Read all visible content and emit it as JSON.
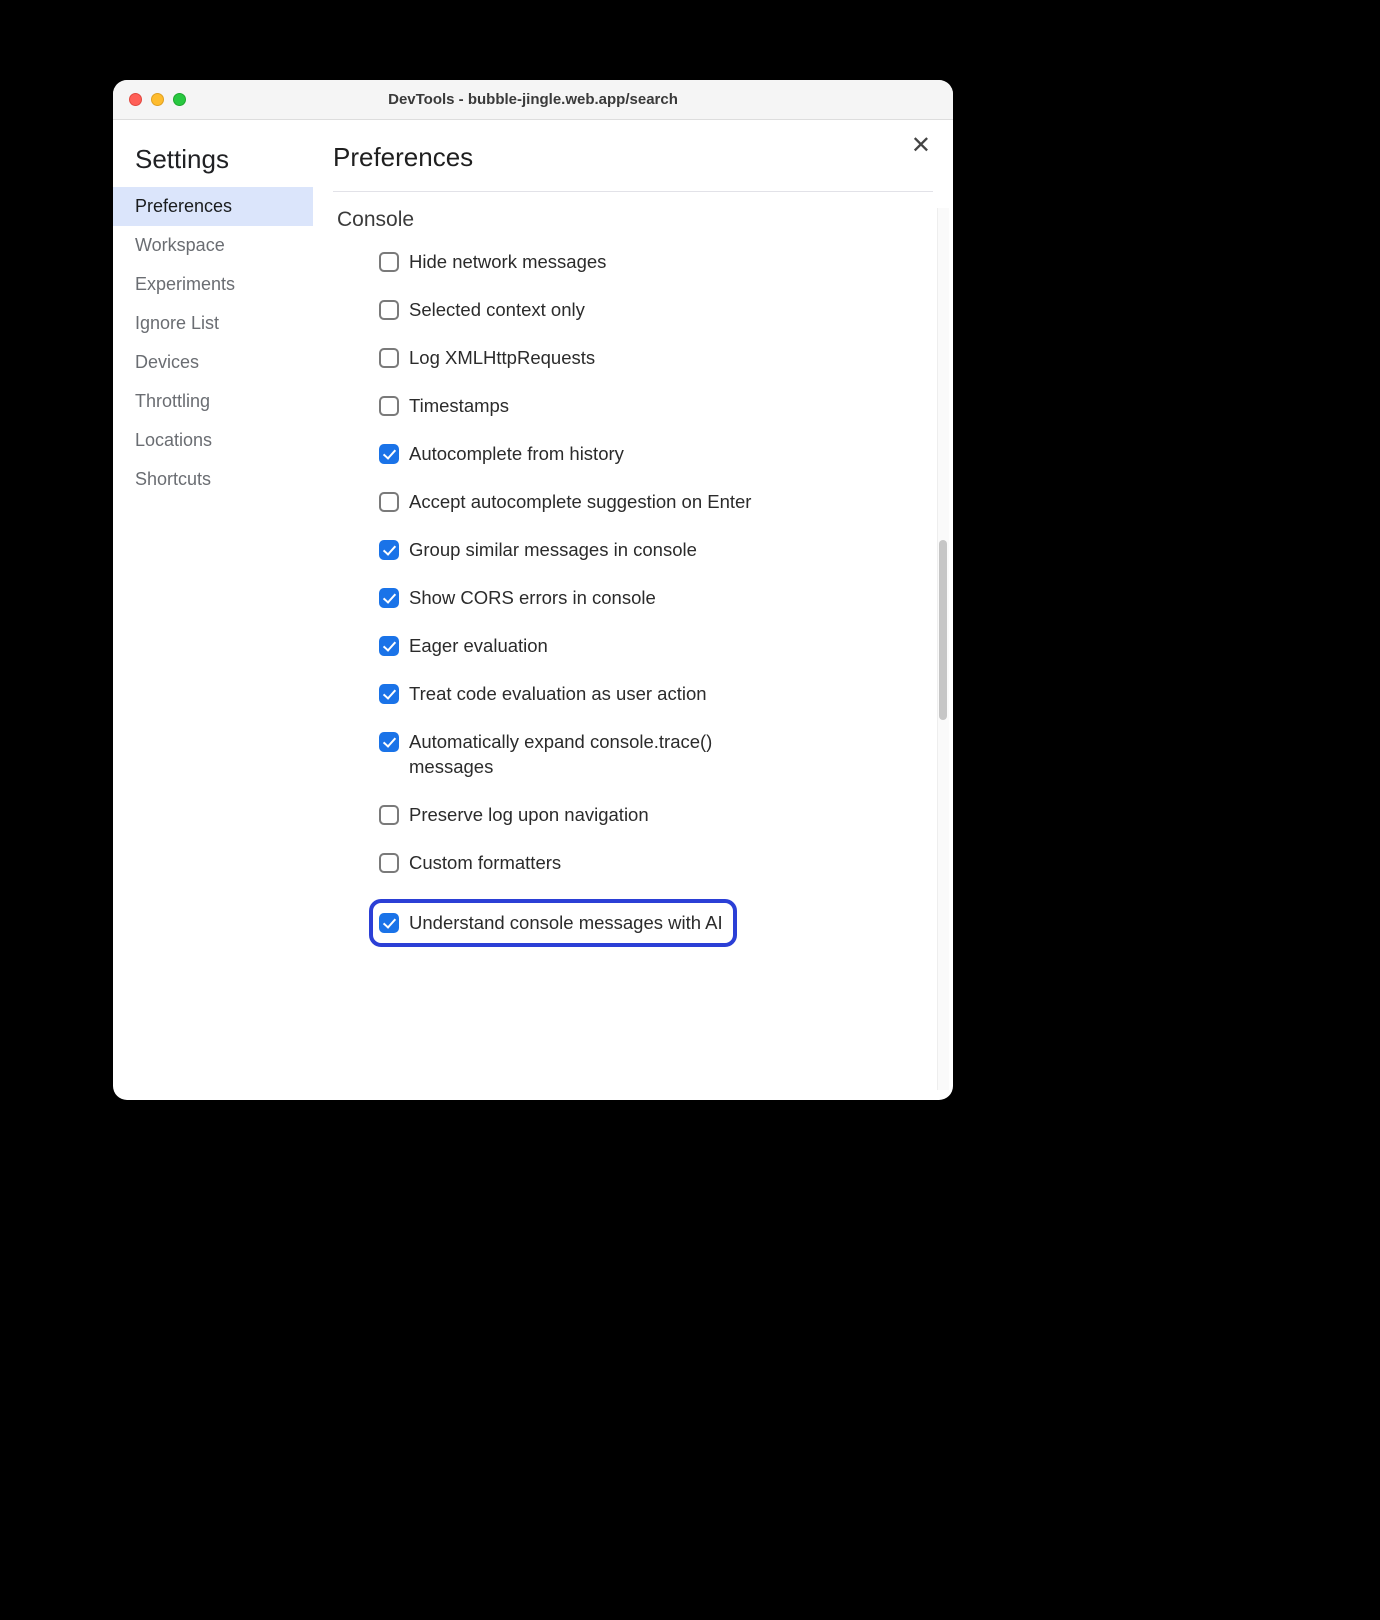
{
  "window": {
    "title": "DevTools - bubble-jingle.web.app/search"
  },
  "sidebar": {
    "heading": "Settings",
    "items": [
      {
        "label": "Preferences",
        "selected": true
      },
      {
        "label": "Workspace",
        "selected": false
      },
      {
        "label": "Experiments",
        "selected": false
      },
      {
        "label": "Ignore List",
        "selected": false
      },
      {
        "label": "Devices",
        "selected": false
      },
      {
        "label": "Throttling",
        "selected": false
      },
      {
        "label": "Locations",
        "selected": false
      },
      {
        "label": "Shortcuts",
        "selected": false
      }
    ]
  },
  "main": {
    "title": "Preferences",
    "section": "Console",
    "options": [
      {
        "label": "Hide network messages",
        "checked": false,
        "highlight": false
      },
      {
        "label": "Selected context only",
        "checked": false,
        "highlight": false
      },
      {
        "label": "Log XMLHttpRequests",
        "checked": false,
        "highlight": false
      },
      {
        "label": "Timestamps",
        "checked": false,
        "highlight": false
      },
      {
        "label": "Autocomplete from history",
        "checked": true,
        "highlight": false
      },
      {
        "label": "Accept autocomplete suggestion on Enter",
        "checked": false,
        "highlight": false
      },
      {
        "label": "Group similar messages in console",
        "checked": true,
        "highlight": false
      },
      {
        "label": "Show CORS errors in console",
        "checked": true,
        "highlight": false
      },
      {
        "label": "Eager evaluation",
        "checked": true,
        "highlight": false
      },
      {
        "label": "Treat code evaluation as user action",
        "checked": true,
        "highlight": false
      },
      {
        "label": "Automatically expand console.trace() messages",
        "checked": true,
        "highlight": false
      },
      {
        "label": "Preserve log upon navigation",
        "checked": false,
        "highlight": false
      },
      {
        "label": "Custom formatters",
        "checked": false,
        "highlight": false
      },
      {
        "label": "Understand console messages with AI",
        "checked": true,
        "highlight": true
      }
    ]
  }
}
